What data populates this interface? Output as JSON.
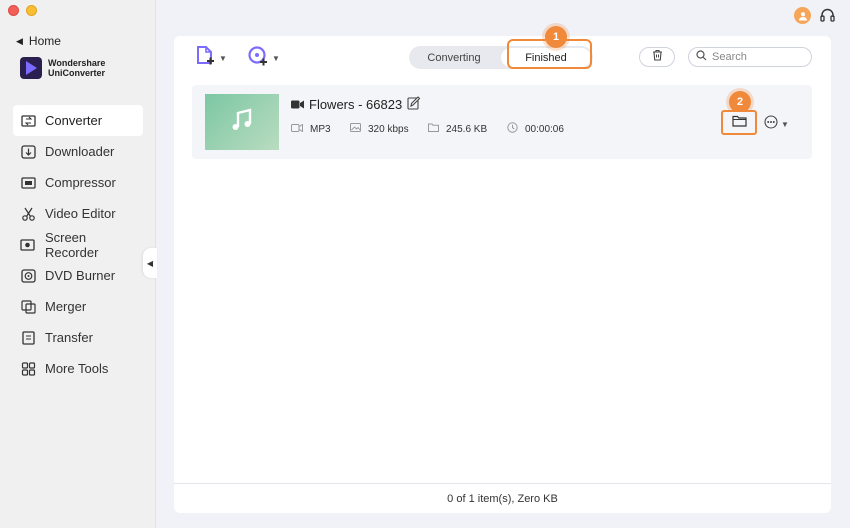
{
  "window": {
    "title": "Wondershare UniConverter"
  },
  "sidebar": {
    "home_label": "Home",
    "brand_line1": "Wondershare",
    "brand_line2": "UniConverter",
    "items": [
      {
        "label": "Converter",
        "icon": "converter-icon",
        "active": true
      },
      {
        "label": "Downloader",
        "icon": "download-icon"
      },
      {
        "label": "Compressor",
        "icon": "compress-icon"
      },
      {
        "label": "Video Editor",
        "icon": "scissors-icon"
      },
      {
        "label": "Screen Recorder",
        "icon": "record-icon"
      },
      {
        "label": "DVD Burner",
        "icon": "disc-icon"
      },
      {
        "label": "Merger",
        "icon": "merge-icon"
      },
      {
        "label": "Transfer",
        "icon": "transfer-icon"
      },
      {
        "label": "More Tools",
        "icon": "grid-icon"
      }
    ]
  },
  "toolbar": {
    "tabs": [
      {
        "label": "Converting",
        "active": false
      },
      {
        "label": "Finished",
        "active": true
      }
    ],
    "search_placeholder": "Search"
  },
  "annotations": {
    "step1": "1",
    "step2": "2"
  },
  "file": {
    "name": "Flowers - 66823",
    "format": "MP3",
    "bitrate": "320 kbps",
    "size": "245.6 KB",
    "duration": "00:00:06"
  },
  "footer": {
    "status": "0 of 1 item(s), Zero KB"
  },
  "colors": {
    "accent": "#f0893a",
    "purple": "#7b6bff",
    "thumb": "#8ccfac"
  }
}
